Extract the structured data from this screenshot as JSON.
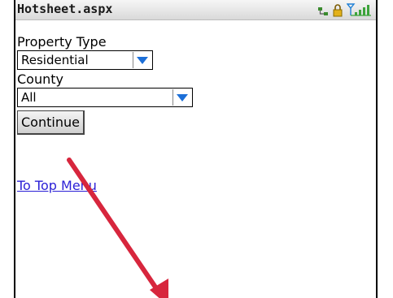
{
  "title": "Hotsheet.aspx",
  "status_icons": [
    "network-icon",
    "lock-icon",
    "signal-strength-icon"
  ],
  "form": {
    "property_type_label": "Property Type",
    "property_type_value": "Residential",
    "county_label": "County",
    "county_value": "All",
    "continue_label": "Continue"
  },
  "link_text": "To Top Menu",
  "colors": {
    "link": "#2a1fd6",
    "dropdown_arrow": "#1c6fd8",
    "annotation_arrow": "#d7263d"
  }
}
